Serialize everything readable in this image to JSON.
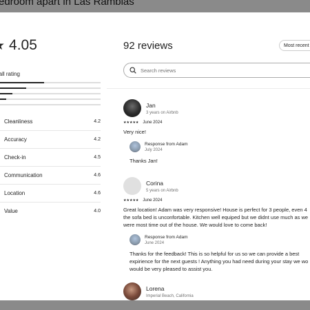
{
  "listing_title": "edroom apart in Las Ramblas",
  "rating": {
    "value": "4.05",
    "overall_label": "rall rating",
    "distribution": [
      {
        "fraction": 0.44
      },
      {
        "fraction": 0.26
      },
      {
        "fraction": 0.12
      },
      {
        "fraction": 0.06
      },
      {
        "fraction": 0.0
      }
    ]
  },
  "categories": [
    {
      "label": "Cleanliness",
      "score": "4.2"
    },
    {
      "label": "Accuracy",
      "score": "4.2"
    },
    {
      "label": "Check-in",
      "score": "4.5"
    },
    {
      "label": "Communication",
      "score": "4.6"
    },
    {
      "label": "Location",
      "score": "4.6"
    },
    {
      "label": "Value",
      "score": "4.0"
    }
  ],
  "reviews_header": {
    "title": "92 reviews",
    "sort_label": "Most recent",
    "search_placeholder": "Search reviews"
  },
  "reviews": [
    {
      "name": "Jan",
      "subtitle": "3 years on Airbnb",
      "stars": "★★★★★",
      "date": "June 2024",
      "text": "Very nice!",
      "response_title": "Response from Adam",
      "response_date": "July 2024",
      "response_text": "Thanks Jan!"
    },
    {
      "name": "Corina",
      "subtitle": "5 years on Airbnb",
      "stars": "★★★★★",
      "date": "June 2024",
      "text": "Great location! Adam was very responsive! House is perfect for 3 people, even 4\nthe sofa bed is unconfortable. Kitchen well equiped but we didnt use much as we\nwere most time out of the house. We would love to come back!",
      "response_title": "Response from Adam",
      "response_date": "June 2024",
      "response_text": "Thanks for the feedback! This is so helpful for us so we can provide a best\nexpirience for the next guests ! Anything you had need during your stay we wo\nwould be very pleased to assist you."
    },
    {
      "name": "Lorena",
      "subtitle": "Imperial Beach, California"
    }
  ]
}
